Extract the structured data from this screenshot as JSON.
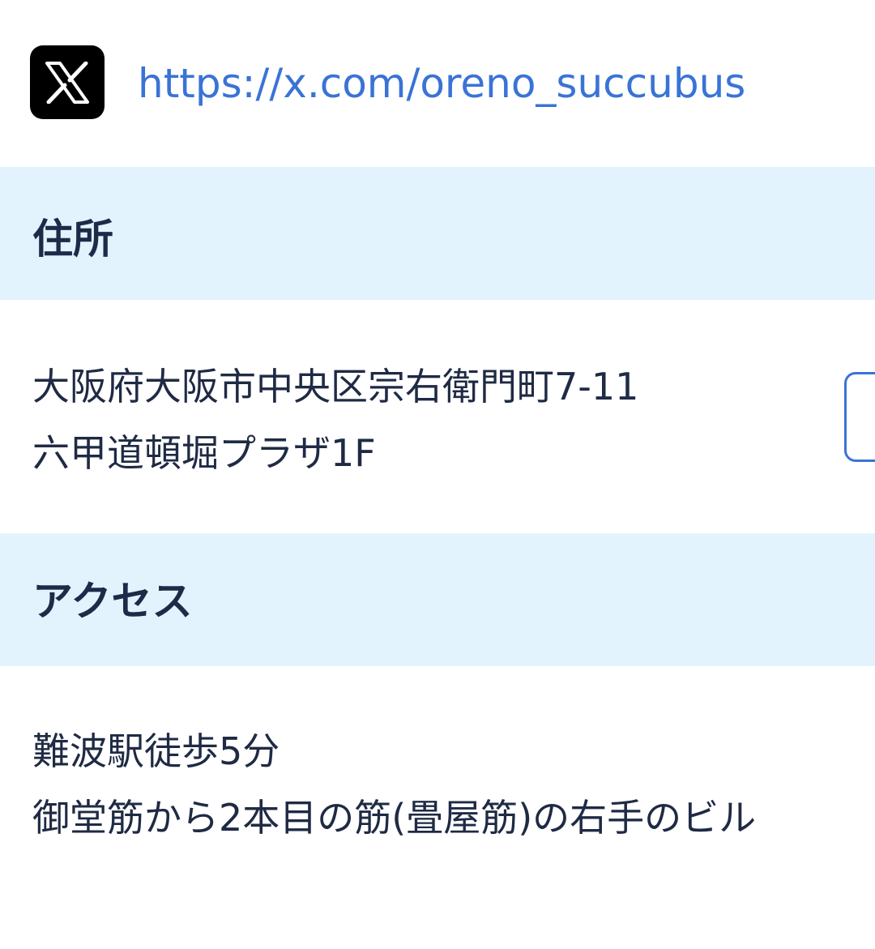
{
  "x_account": {
    "icon": "x-logo-icon",
    "url": "https://x.com/oreno_succubus"
  },
  "address_section": {
    "title": "住所",
    "lines": [
      "大阪府大阪市中央区宗右衛門町7-11",
      "六甲道頓堀プラザ1F"
    ]
  },
  "access_section": {
    "title": "アクセス",
    "lines": [
      "難波駅徒歩5分",
      "御堂筋から2本目の筋(畳屋筋)の右手のビル"
    ]
  },
  "colors": {
    "link": "#3a73d6",
    "header_background": "#e2f3fd",
    "heading_text": "#1d2b49"
  }
}
